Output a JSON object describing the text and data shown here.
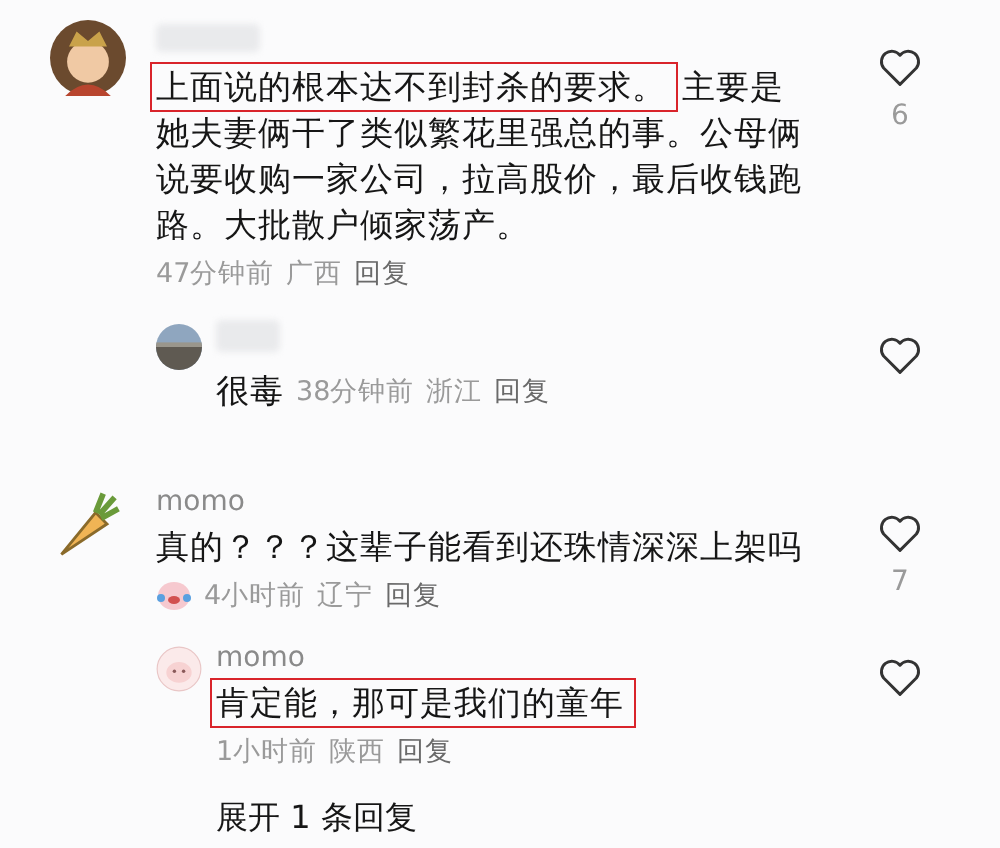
{
  "comments": [
    {
      "name_hidden": true,
      "text": [
        {
          "text": "上面说的根本达不到封杀的要求。",
          "highlighted": true
        },
        {
          "text": "主要是她夫妻俩干了类似繁花里强总的事。公母俩说要收购一家公司，拉高股价，最后收钱跑路。大批散户倾家荡产。",
          "highlighted": false
        }
      ],
      "likes": "6",
      "sticker": false,
      "meta": [
        "47分钟前",
        "广西",
        "回复"
      ],
      "replies": [
        {
          "name_hidden": true,
          "text": [
            {
              "text": "很毒",
              "highlighted": false
            }
          ],
          "meta_inline": true,
          "meta": [
            "38分钟前",
            "浙江",
            "回复"
          ]
        }
      ]
    },
    {
      "author": "momo",
      "text": [
        {
          "text": "真的？？？这辈子能看到还珠情深深上架吗",
          "highlighted": false
        }
      ],
      "likes": "7",
      "sticker": true,
      "meta": [
        "4小时前",
        "辽宁",
        "回复"
      ],
      "replies": [
        {
          "author": "momo",
          "text": [
            {
              "text": "肯定能，那可是我们的童年",
              "highlighted": true
            }
          ],
          "meta_inline": false,
          "meta": [
            "1小时前",
            "陕西",
            "回复"
          ]
        }
      ],
      "expand": "展开 1 条回复"
    }
  ]
}
